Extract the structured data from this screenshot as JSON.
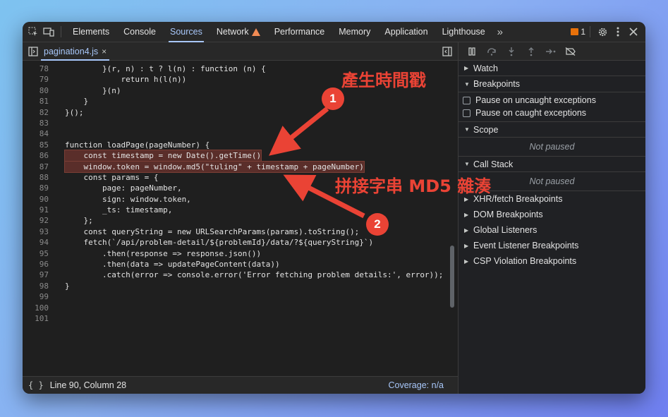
{
  "toolbar": {
    "tabs": [
      "Elements",
      "Console",
      "Sources",
      "Network",
      "Performance",
      "Memory",
      "Application",
      "Lighthouse"
    ],
    "active_tab": "Sources",
    "more": "»",
    "issues_count": "1"
  },
  "file_tab": {
    "name": "pagination4.js",
    "close": "×"
  },
  "code_lines": [
    {
      "n": "78",
      "t": "        }(r, n) : t ? l(n) : function (n) {"
    },
    {
      "n": "79",
      "t": "            return h(l(n))"
    },
    {
      "n": "80",
      "t": "        }(n)"
    },
    {
      "n": "81",
      "t": "    }"
    },
    {
      "n": "82",
      "t": "}();"
    },
    {
      "n": "83",
      "t": ""
    },
    {
      "n": "84",
      "t": ""
    },
    {
      "n": "85",
      "t": "function loadPage(pageNumber) {"
    },
    {
      "n": "86",
      "t": "    const timestamp = new Date().getTime()"
    },
    {
      "n": "87",
      "t": "    window.token = window.md5(\"tuling\" + timestamp + pageNumber)"
    },
    {
      "n": "88",
      "t": "    const params = {"
    },
    {
      "n": "89",
      "t": "        page: pageNumber,"
    },
    {
      "n": "90",
      "t": "        sign: window.token,"
    },
    {
      "n": "91",
      "t": "        _ts: timestamp,"
    },
    {
      "n": "92",
      "t": "    };"
    },
    {
      "n": "93",
      "t": "    const queryString = new URLSearchParams(params).toString();"
    },
    {
      "n": "94",
      "t": "    fetch(`/api/problem-detail/${problemId}/data/?${queryString}`)"
    },
    {
      "n": "95",
      "t": "        .then(response => response.json())"
    },
    {
      "n": "96",
      "t": "        .then(data => updatePageContent(data))"
    },
    {
      "n": "97",
      "t": "        .catch(error => console.error('Error fetching problem details:', error));"
    },
    {
      "n": "98",
      "t": "}"
    },
    {
      "n": "99",
      "t": ""
    },
    {
      "n": "100",
      "t": ""
    },
    {
      "n": "101",
      "t": ""
    }
  ],
  "status": {
    "brace": "{ }",
    "position": "Line 90, Column 28",
    "coverage": "Coverage: n/a"
  },
  "right_pane": {
    "watch": "Watch",
    "breakpoints": "Breakpoints",
    "pause_uncaught": "Pause on uncaught exceptions",
    "pause_caught": "Pause on caught exceptions",
    "scope": "Scope",
    "scope_not_paused": "Not paused",
    "call_stack": "Call Stack",
    "callstack_not_paused": "Not paused",
    "xhr": "XHR/fetch Breakpoints",
    "dom": "DOM Breakpoints",
    "global": "Global Listeners",
    "event": "Event Listener Breakpoints",
    "csp": "CSP Violation Breakpoints"
  },
  "annotations": {
    "label1": "產生時間戳",
    "label2": "拼接字串 MD5 雜湊",
    "badge1": "1",
    "badge2": "2",
    "color": "#ea4335"
  }
}
